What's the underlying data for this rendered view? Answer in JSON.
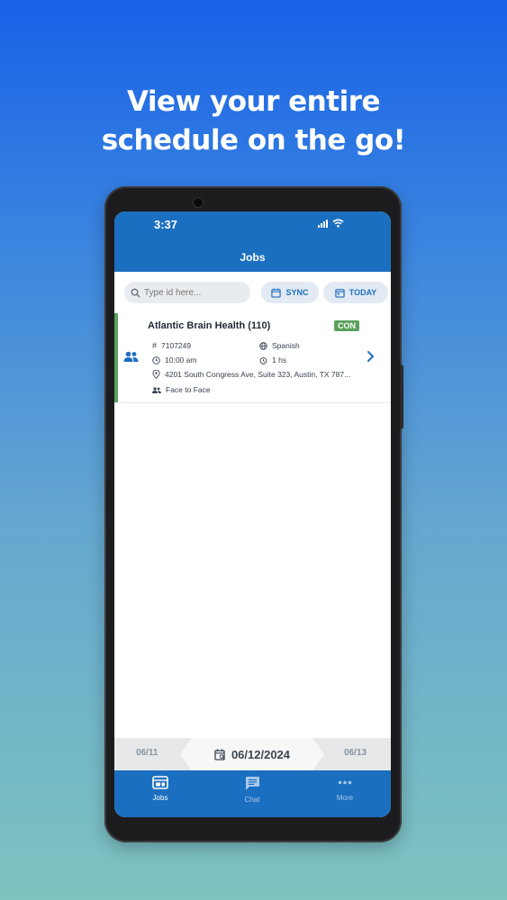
{
  "promo": {
    "headline_line1": "View your entire",
    "headline_line2": "schedule on the go!"
  },
  "status_bar": {
    "time": "3:37"
  },
  "header": {
    "title": "Jobs"
  },
  "toolbar": {
    "search_placeholder": "Type id here...",
    "sync_label": "SYNC",
    "today_label": "TODAY"
  },
  "jobs": [
    {
      "title": "Atlantic Brain Health (110)",
      "status": "CON",
      "id": "7107249",
      "language": "Spanish",
      "time": "10:00 am",
      "duration": "1 hs",
      "address": "4201 South Congress Ave, Suite 323, Austin, TX 787...",
      "modality": "Face to Face"
    }
  ],
  "date_nav": {
    "prev": "06/11",
    "current": "06/12/2024",
    "next": "06/13"
  },
  "bottom_nav": [
    {
      "label": "Jobs",
      "icon": "jobs-icon",
      "active": true
    },
    {
      "label": "Chat",
      "icon": "chat-icon",
      "active": false
    },
    {
      "label": "More",
      "icon": "more-icon",
      "active": false
    }
  ],
  "colors": {
    "primary": "#1b6fc0",
    "status_green": "#5aa05c",
    "background_top": "#1762e8",
    "background_bottom": "#7fc3c0"
  }
}
